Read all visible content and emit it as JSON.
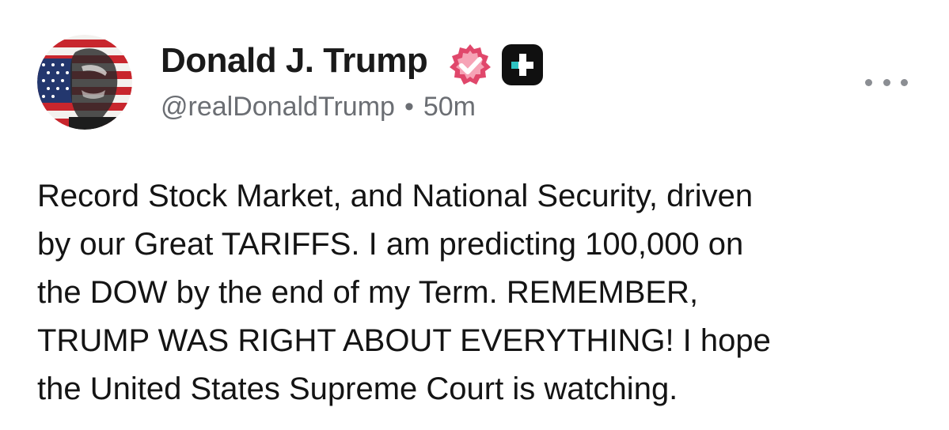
{
  "post": {
    "author": {
      "display_name": "Donald J. Trump",
      "handle": "@realDonaldTrump",
      "separator": "•",
      "timestamp": "50m"
    },
    "badges": {
      "verified": "verified-badge-icon",
      "plus": "plus-badge-icon",
      "verified_color": "#e0476b",
      "plus_color": "#101010",
      "plus_accent": "#2ec4c4"
    },
    "menu_icon": "more-horizontal-icon",
    "body_lines": [
      "Record Stock Market, and National Security, driven",
      "by our Great TARIFFS. I am predicting 100,000 on",
      "the DOW by the end of my Term. REMEMBER,",
      "TRUMP WAS RIGHT ABOUT EVERYTHING! I hope",
      "the United States Supreme Court is watching."
    ]
  }
}
